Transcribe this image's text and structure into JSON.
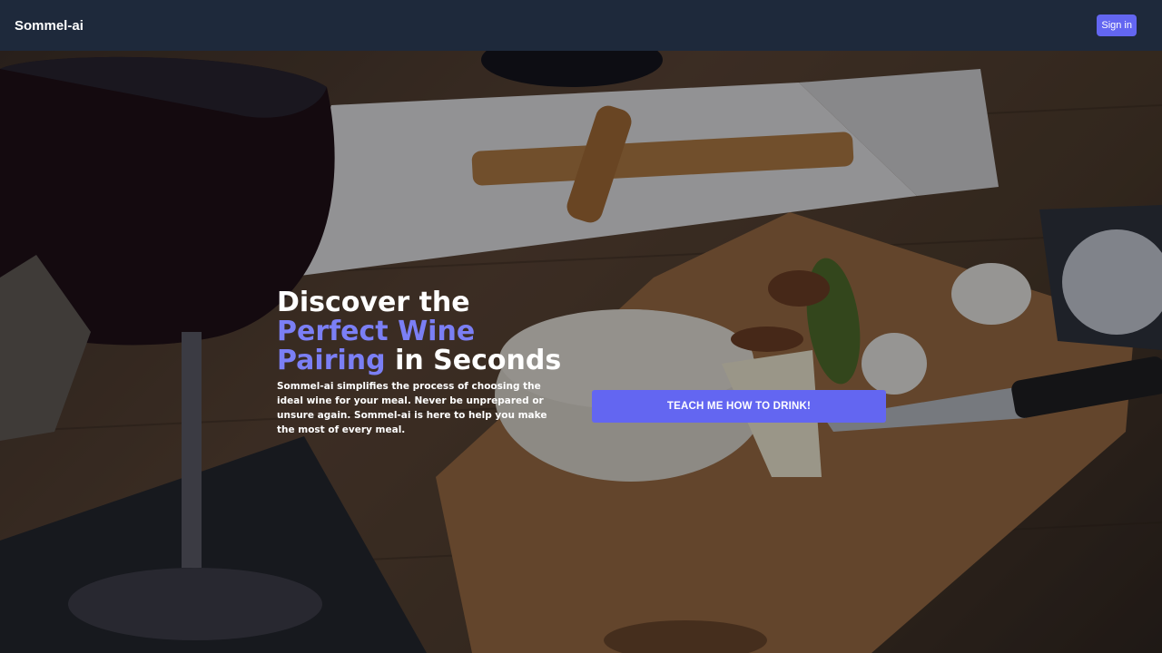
{
  "nav": {
    "brand": "Sommel-ai",
    "signin_label": "Sign in"
  },
  "hero": {
    "headline_line1": "Discover the",
    "headline_accent": "Perfect Wine Pairing",
    "headline_line2": " in Seconds",
    "description": "Sommel-ai simplifies the process of choosing the ideal wine for your meal. Never be unprepared or unsure again. Sommel-ai is here to help you make the most of every meal.",
    "cta_label": "TEACH ME HOW TO DRINK!"
  },
  "colors": {
    "nav_bg": "#1e293b",
    "accent": "#6366f1",
    "headline_accent": "#7b7ff5",
    "text": "#ffffff"
  }
}
